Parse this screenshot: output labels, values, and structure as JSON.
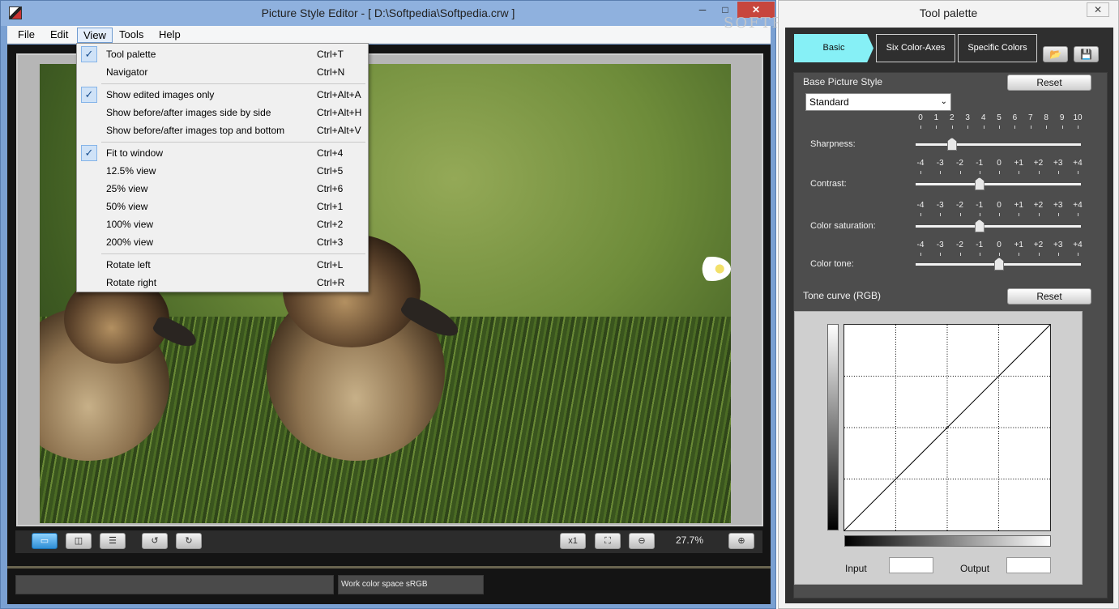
{
  "main_window": {
    "title": "Picture Style Editor - [ D:\\Softpedia\\Softpedia.crw ]",
    "min_glyph": "─",
    "max_glyph": "□",
    "close_glyph": "✕"
  },
  "menubar": {
    "items": [
      {
        "label": "File"
      },
      {
        "label": "Edit"
      },
      {
        "label": "View"
      },
      {
        "label": "Tools"
      },
      {
        "label": "Help"
      }
    ]
  },
  "view_menu": {
    "items": [
      {
        "label": "Tool palette",
        "shortcut": "Ctrl+T",
        "checked": true
      },
      {
        "label": "Navigator",
        "shortcut": "Ctrl+N",
        "checked": false
      },
      {
        "label": "Show edited images only",
        "shortcut": "Ctrl+Alt+A",
        "checked": true
      },
      {
        "label": "Show before/after images side by side",
        "shortcut": "Ctrl+Alt+H",
        "checked": false
      },
      {
        "label": "Show before/after images top and bottom",
        "shortcut": "Ctrl+Alt+V",
        "checked": false
      },
      {
        "label": "Fit to window",
        "shortcut": "Ctrl+4",
        "checked": true
      },
      {
        "label": "12.5% view",
        "shortcut": "Ctrl+5",
        "checked": false
      },
      {
        "label": "25% view",
        "shortcut": "Ctrl+6",
        "checked": false
      },
      {
        "label": "50% view",
        "shortcut": "Ctrl+1",
        "checked": false
      },
      {
        "label": "100% view",
        "shortcut": "Ctrl+2",
        "checked": false
      },
      {
        "label": "200% view",
        "shortcut": "Ctrl+3",
        "checked": false
      },
      {
        "label": "Rotate left",
        "shortcut": "Ctrl+L",
        "checked": false
      },
      {
        "label": "Rotate right",
        "shortcut": "Ctrl+R",
        "checked": false
      }
    ],
    "check_glyph": "✓"
  },
  "bottom_toolbar": {
    "zoom": "27.7%",
    "x1_label": "x1"
  },
  "status": {
    "work_color_space": "Work color space  sRGB"
  },
  "tool_palette": {
    "title": "Tool palette",
    "close_glyph": "✕",
    "watermark": "SOFTPEDIA",
    "tabs": [
      {
        "label": "Basic"
      },
      {
        "label": "Six Color-Axes"
      },
      {
        "label": "Specific Colors"
      }
    ],
    "base_picture_style": {
      "label": "Base Picture Style",
      "reset": "Reset",
      "selected": "Standard",
      "arrow": "⌄"
    },
    "sliders": [
      {
        "label": "Sharpness:",
        "scale": [
          "0",
          "1",
          "2",
          "3",
          "4",
          "5",
          "6",
          "7",
          "8",
          "9",
          "10"
        ],
        "value_fraction": 0.2
      },
      {
        "label": "Contrast:",
        "scale": [
          "-4",
          "-3",
          "-2",
          "-1",
          "0",
          "+1",
          "+2",
          "+3",
          "+4"
        ],
        "value_fraction": 0.375
      },
      {
        "label": "Color saturation:",
        "scale": [
          "-4",
          "-3",
          "-2",
          "-1",
          "0",
          "+1",
          "+2",
          "+3",
          "+4"
        ],
        "value_fraction": 0.375
      },
      {
        "label": "Color tone:",
        "scale": [
          "-4",
          "-3",
          "-2",
          "-1",
          "0",
          "+1",
          "+2",
          "+3",
          "+4"
        ],
        "value_fraction": 0.5
      }
    ],
    "tone_curve": {
      "label": "Tone curve (RGB)",
      "reset": "Reset",
      "input_label": "Input",
      "output_label": "Output"
    }
  }
}
